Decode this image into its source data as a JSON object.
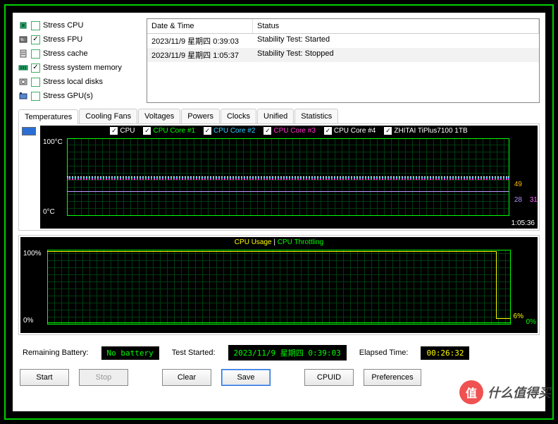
{
  "stress": [
    {
      "label": "Stress CPU",
      "checked": false,
      "icon": "cpu"
    },
    {
      "label": "Stress FPU",
      "checked": true,
      "icon": "fpu"
    },
    {
      "label": "Stress cache",
      "checked": false,
      "icon": "cache"
    },
    {
      "label": "Stress system memory",
      "checked": true,
      "icon": "ram"
    },
    {
      "label": "Stress local disks",
      "checked": false,
      "icon": "disk"
    },
    {
      "label": "Stress GPU(s)",
      "checked": false,
      "icon": "gpu"
    }
  ],
  "log": {
    "headers": {
      "dt": "Date & Time",
      "status": "Status"
    },
    "rows": [
      {
        "dt": "2023/11/9 星期四 0:39:03",
        "status": "Stability Test: Started"
      },
      {
        "dt": "2023/11/9 星期四 1:05:37",
        "status": "Stability Test: Stopped"
      }
    ]
  },
  "tabs": [
    "Temperatures",
    "Cooling Fans",
    "Voltages",
    "Powers",
    "Clocks",
    "Unified",
    "Statistics"
  ],
  "active_tab": 0,
  "chart_data": {
    "temp": {
      "type": "line",
      "ylabel": "°C",
      "ylim": [
        0,
        100
      ],
      "ylabels": {
        "top": "100°C",
        "bottom": "0°C"
      },
      "xend": "1:05:36",
      "series": [
        {
          "name": "CPU",
          "color": "#ffffff",
          "approx_value": 49
        },
        {
          "name": "CPU Core #1",
          "color": "#00ff00",
          "approx_value": 49
        },
        {
          "name": "CPU Core #2",
          "color": "#33ccff",
          "approx_value": 49
        },
        {
          "name": "CPU Core #3",
          "color": "#ff33cc",
          "approx_value": 49
        },
        {
          "name": "CPU Core #4",
          "color": "#ffffff",
          "approx_value": 49
        },
        {
          "name": "ZHITAI TiPlus7100 1TB",
          "color": "#ffffff",
          "approx_value": 31
        }
      ],
      "right_labels": [
        {
          "text": "49",
          "color": "#ffbb00",
          "top_pct": 51
        },
        {
          "text": "28",
          "color": "#b090ff",
          "top_pct": 66
        },
        {
          "text": "31",
          "color": "#ff66ff",
          "top_pct": 66,
          "right": 0
        }
      ]
    },
    "usage": {
      "type": "line",
      "title_a": "CPU Usage",
      "title_sep": "|",
      "title_b": "CPU Throttling",
      "color_a": "#ffff00",
      "color_b": "#00ff00",
      "ylim": [
        0,
        100
      ],
      "ylabels": {
        "top": "100%",
        "bottom": "0%"
      },
      "end_labels": {
        "usage": "6%",
        "throttling": "0%"
      }
    }
  },
  "status": {
    "battery_label": "Remaining Battery:",
    "battery_value": "No battery",
    "started_label": "Test Started:",
    "started_value": "2023/11/9 星期四 0:39:03",
    "elapsed_label": "Elapsed Time:",
    "elapsed_value": "00:26:32"
  },
  "buttons": {
    "start": "Start",
    "stop": "Stop",
    "clear": "Clear",
    "save": "Save",
    "cpuid": "CPUID",
    "prefs": "Preferences"
  },
  "watermark": {
    "icon": "值",
    "text": "什么值得买"
  },
  "colors": {
    "accent_green": "#00d000",
    "value_yellow": "#ffff00"
  }
}
